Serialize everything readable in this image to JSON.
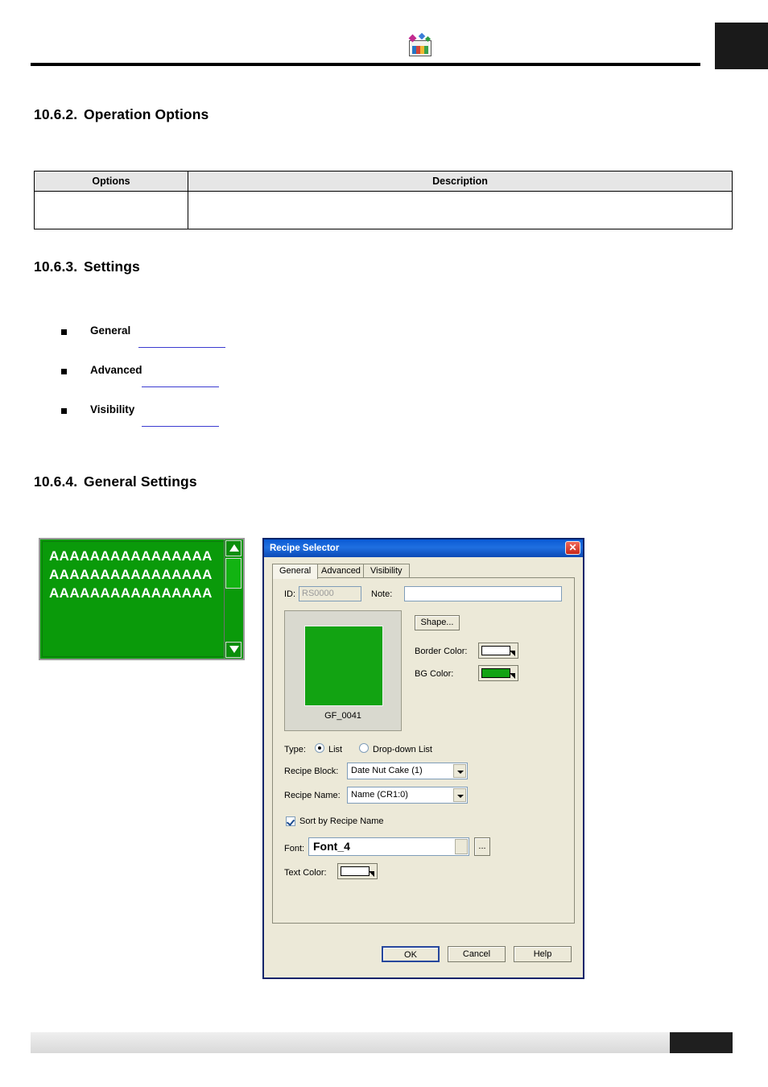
{
  "header": {
    "logo_name": "application-logo"
  },
  "sections": {
    "operation_options": {
      "number": "10.6.2.",
      "title": "Operation Options"
    },
    "settings": {
      "number": "10.6.3.",
      "title": "Settings"
    },
    "general_settings": {
      "number": "10.6.4.",
      "title": "General Settings"
    }
  },
  "table": {
    "headers": [
      "Options",
      "Description"
    ],
    "rows": [
      [
        "",
        ""
      ]
    ]
  },
  "bullets": [
    {
      "label": "General"
    },
    {
      "label": "Advanced"
    },
    {
      "label": "Visibility"
    }
  ],
  "widget_preview": {
    "lines": [
      "AAAAAAAAAAAAAAAA",
      "AAAAAAAAAAAAAAAA",
      "AAAAAAAAAAAAAAAA"
    ],
    "bg_color": "#0a9a0a",
    "text_color": "#ffffff",
    "scroll_up_icon": "triangle-up-icon",
    "scroll_down_icon": "triangle-down-icon"
  },
  "dialog": {
    "title": "Recipe Selector",
    "close_label": "✕",
    "tabs": [
      {
        "label": "General",
        "active": true
      },
      {
        "label": "Advanced",
        "active": false
      },
      {
        "label": "Visibility",
        "active": false
      }
    ],
    "id_label": "ID:",
    "id_value": "RS0000",
    "note_label": "Note:",
    "note_value": "",
    "preview_caption": "GF_0041",
    "preview_color": "#12a312",
    "shape_button": "Shape...",
    "border_color_label": "Border Color:",
    "border_color_value": "#ffffff",
    "bg_color_label": "BG Color:",
    "bg_color_value": "#12a312",
    "type_label": "Type:",
    "type_options": [
      {
        "label": "List",
        "selected": true
      },
      {
        "label": "Drop-down List",
        "selected": false
      }
    ],
    "recipe_block_label": "Recipe Block:",
    "recipe_block_value": "Date Nut Cake (1)",
    "recipe_name_label": "Recipe Name:",
    "recipe_name_value": "Name (CR1:0)",
    "sort_checkbox_label": "Sort by Recipe Name",
    "sort_checked": true,
    "font_label": "Font:",
    "font_value": "Font_4",
    "font_browse_label": "...",
    "text_color_label": "Text Color:",
    "text_color_value": "#ffffff",
    "buttons": {
      "ok": "OK",
      "cancel": "Cancel",
      "help": "Help"
    }
  }
}
